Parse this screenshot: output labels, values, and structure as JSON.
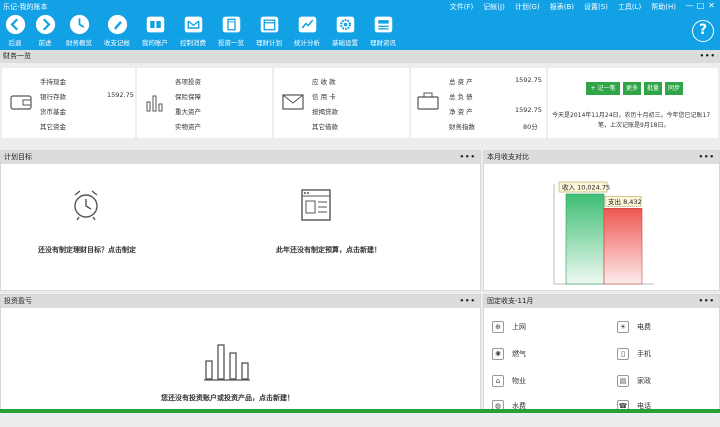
{
  "window": {
    "title": "乐记-我的账本",
    "controls": [
      "—",
      "□",
      "✕"
    ]
  },
  "menu": [
    "文件(F)",
    "记帐(J)",
    "计划(G)",
    "报表(B)",
    "设置(S)",
    "工具(L)",
    "帮助(H)"
  ],
  "toolbar": [
    {
      "label": "后退",
      "icon": "back-icon"
    },
    {
      "label": "前进",
      "icon": "forward-icon"
    },
    {
      "label": "财务概览",
      "icon": "overview-icon"
    },
    {
      "label": "收支记帐",
      "icon": "pen-icon"
    },
    {
      "label": "我的账户",
      "icon": "account-icon"
    },
    {
      "label": "控制消费",
      "icon": "mail-icon"
    },
    {
      "label": "投资一览",
      "icon": "calculator-icon"
    },
    {
      "label": "理财计划",
      "icon": "calendar-icon"
    },
    {
      "label": "统计分析",
      "icon": "chart-icon"
    },
    {
      "label": "基础设置",
      "icon": "gear-icon"
    },
    {
      "label": "理财资讯",
      "icon": "news-icon"
    }
  ],
  "help_label": "?",
  "finance": {
    "title": "财务一览",
    "cash": [
      {
        "label": "手持现金",
        "value": ""
      },
      {
        "label": "银行存款",
        "value": "1592.75"
      },
      {
        "label": "货币基金",
        "value": ""
      },
      {
        "label": "其它资金",
        "value": ""
      }
    ],
    "invest": [
      "各项投资",
      "保险保障",
      "重大资产",
      "实物资产"
    ],
    "debt": [
      "应 收 款",
      "信 用 卡",
      "按揭贷款",
      "其它借款"
    ],
    "summary": [
      {
        "label": "总 资 产",
        "value": "1592.75"
      },
      {
        "label": "总 负 债",
        "value": ""
      },
      {
        "label": "净 资 产",
        "value": "1592.75"
      },
      {
        "label": "财务指数",
        "value": "80分"
      }
    ],
    "buttons": {
      "add": "+ 记一笔",
      "more": "更多",
      "batch": "批量",
      "sync": "同步"
    },
    "info_line1": "今天是2014年11月24日，农历十月初三。今年您已记账17",
    "info_line2": "笔，上次记账是9月18日。"
  },
  "plan": {
    "title": "计划目标",
    "goal_msg": "还没有制定理财目标？点击制定",
    "budget_msg": "此年还没有制定预算，点击新建！"
  },
  "monthly": {
    "title": "本月收支对比",
    "income_label": "收入 10,024.75",
    "expense_label": "支出 8,432"
  },
  "profit": {
    "title": "投资盈亏",
    "msg": "您还没有投资账户或投资产品，点击新建！"
  },
  "fixed": {
    "title": "固定收支-11月",
    "items": [
      {
        "label": "上网",
        "icon": "globe-icon",
        "glyph": "⊕"
      },
      {
        "label": "电费",
        "icon": "bulb-icon",
        "glyph": "☀"
      },
      {
        "label": "燃气",
        "icon": "fire-icon",
        "glyph": "✺"
      },
      {
        "label": "手机",
        "icon": "phone-icon",
        "glyph": "▯"
      },
      {
        "label": "物业",
        "icon": "house-icon",
        "glyph": "⌂"
      },
      {
        "label": "家政",
        "icon": "broom-icon",
        "glyph": "▤"
      },
      {
        "label": "水费",
        "icon": "water-icon",
        "glyph": "◍"
      },
      {
        "label": "电话",
        "icon": "telephone-icon",
        "glyph": "☎"
      }
    ]
  },
  "dots": "•••",
  "colors": {
    "accent": "#13a1e6",
    "green": "#2fa548",
    "income": "#4dc77c",
    "expense": "#ef5b56"
  },
  "chart_data": {
    "type": "bar",
    "categories": [
      "收入",
      "支出"
    ],
    "values": [
      10024.75,
      8432
    ],
    "title": "本月收支对比"
  }
}
